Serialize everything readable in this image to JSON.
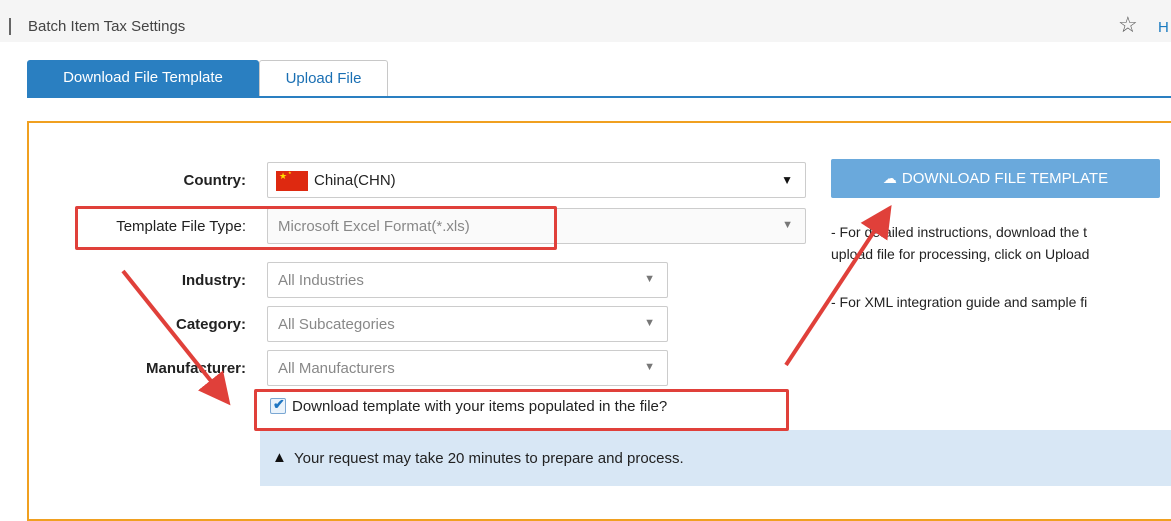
{
  "header": {
    "title": "Batch Item Tax Settings",
    "help": "H"
  },
  "tabs": {
    "active": "Download File Template",
    "upload": "Upload File"
  },
  "form": {
    "country_label": "Country:",
    "country_value": "China(CHN)",
    "file_type_label": "Template File Type:",
    "file_type_value": "Microsoft Excel Format(*.xls)",
    "industry_label": "Industry:",
    "industry_value": "All Industries",
    "category_label": "Category:",
    "category_value": "All Subcategories",
    "manufacturer_label": "Manufacturer:",
    "manufacturer_value": "All Manufacturers",
    "populate_label": "Download template with your items populated in the file?",
    "populate_checked": true
  },
  "download_button": "DOWNLOAD FILE TEMPLATE",
  "info": {
    "line1": "- For detailed instructions, download the t",
    "line2": "upload file for processing, click on Upload",
    "line3": "- For XML integration guide and sample fi"
  },
  "alert": "Your request may take 20 minutes to prepare and process.",
  "colors": {
    "accent": "#2a7fc1",
    "panel_border": "#f0a020",
    "highlight": "#e0403a",
    "alert_bg": "#d8e7f5"
  }
}
